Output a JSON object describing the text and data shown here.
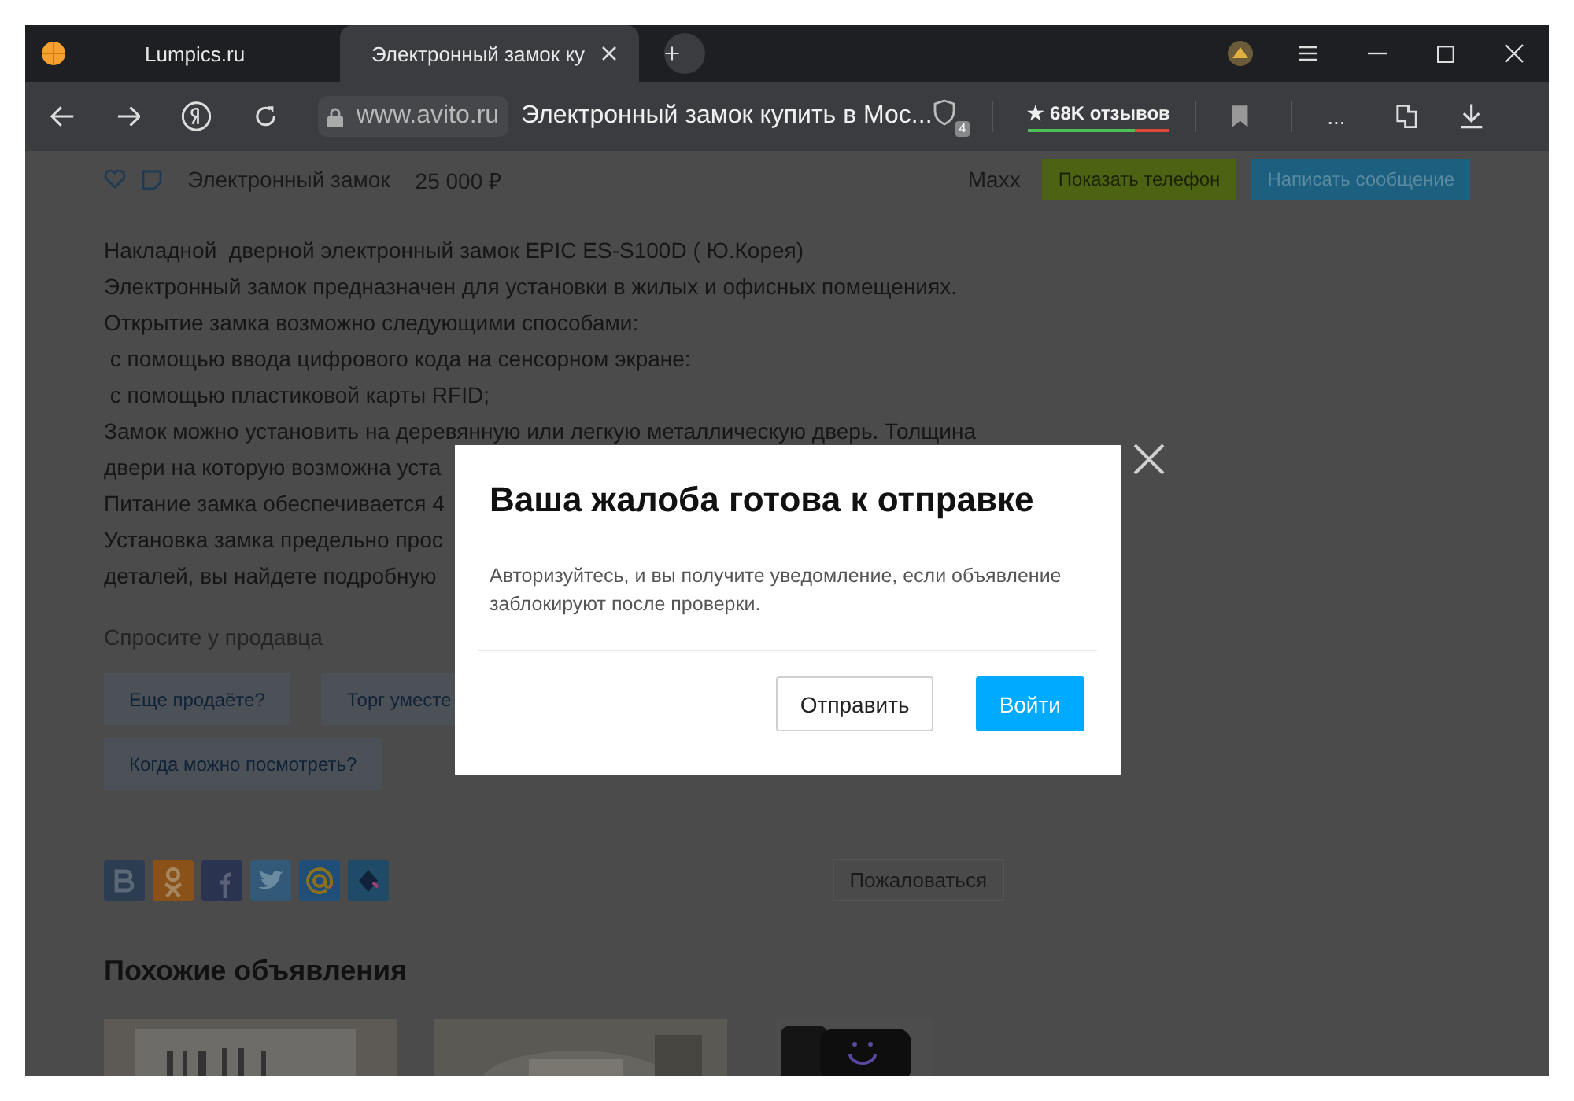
{
  "browser": {
    "tabs": [
      {
        "title": "Lumpics.ru",
        "selected": false
      },
      {
        "title": "Электронный замок ку",
        "selected": true
      }
    ],
    "toolbar": {
      "domain": "www.avito.ru",
      "page_title": "Электронный замок купить в Мос...",
      "shield_badge": "4",
      "reviews": {
        "label": "★ 68K отзывов",
        "level": 0.75
      },
      "more": "..."
    }
  },
  "listing_bar": {
    "title": "Электронный замок",
    "price": "25 000  ₽",
    "seller": "Maxx",
    "buttons": [
      {
        "label": "Показать телефон",
        "kind": "phone"
      },
      {
        "label": "Написать сообщение",
        "kind": "message"
      }
    ]
  },
  "description": [
    "Накладной  дверной электронный замок EPIC ES-S100D ( Ю.Корея)",
    "Электронный замок предназначен для установки в жилых и офисных помещениях.",
    "Открытие замка возможно следующими способами:",
    " с помощью ввода цифрового кода на сенсорном экране:",
    " с помощью пластиковой карты RFID;",
    "Замок можно установить на деревянную или легкую металлическую дверь. Толщина",
    "двери на которую возможна уста",
    "Питание замка обеспечивается 4",
    "Установка замка предельно прос",
    "деталей, вы найдете подробную"
  ],
  "ask_seller": {
    "label": "Спросите у продавца",
    "questions": [
      "Еще продаёте?",
      "Торг уместе",
      "Когда можно посмотреть?"
    ]
  },
  "report_button": "Пожаловаться",
  "similar": {
    "heading": "Похожие объявления"
  },
  "dialog": {
    "title": "Ваша жалоба готова к отправке",
    "text": "Авторизуйтесь, и вы получите уведомление, если объявление заблокируют после проверки.",
    "buttons": [
      {
        "label": "Отправить",
        "primary": false
      },
      {
        "label": "Войти",
        "primary": true
      }
    ]
  }
}
